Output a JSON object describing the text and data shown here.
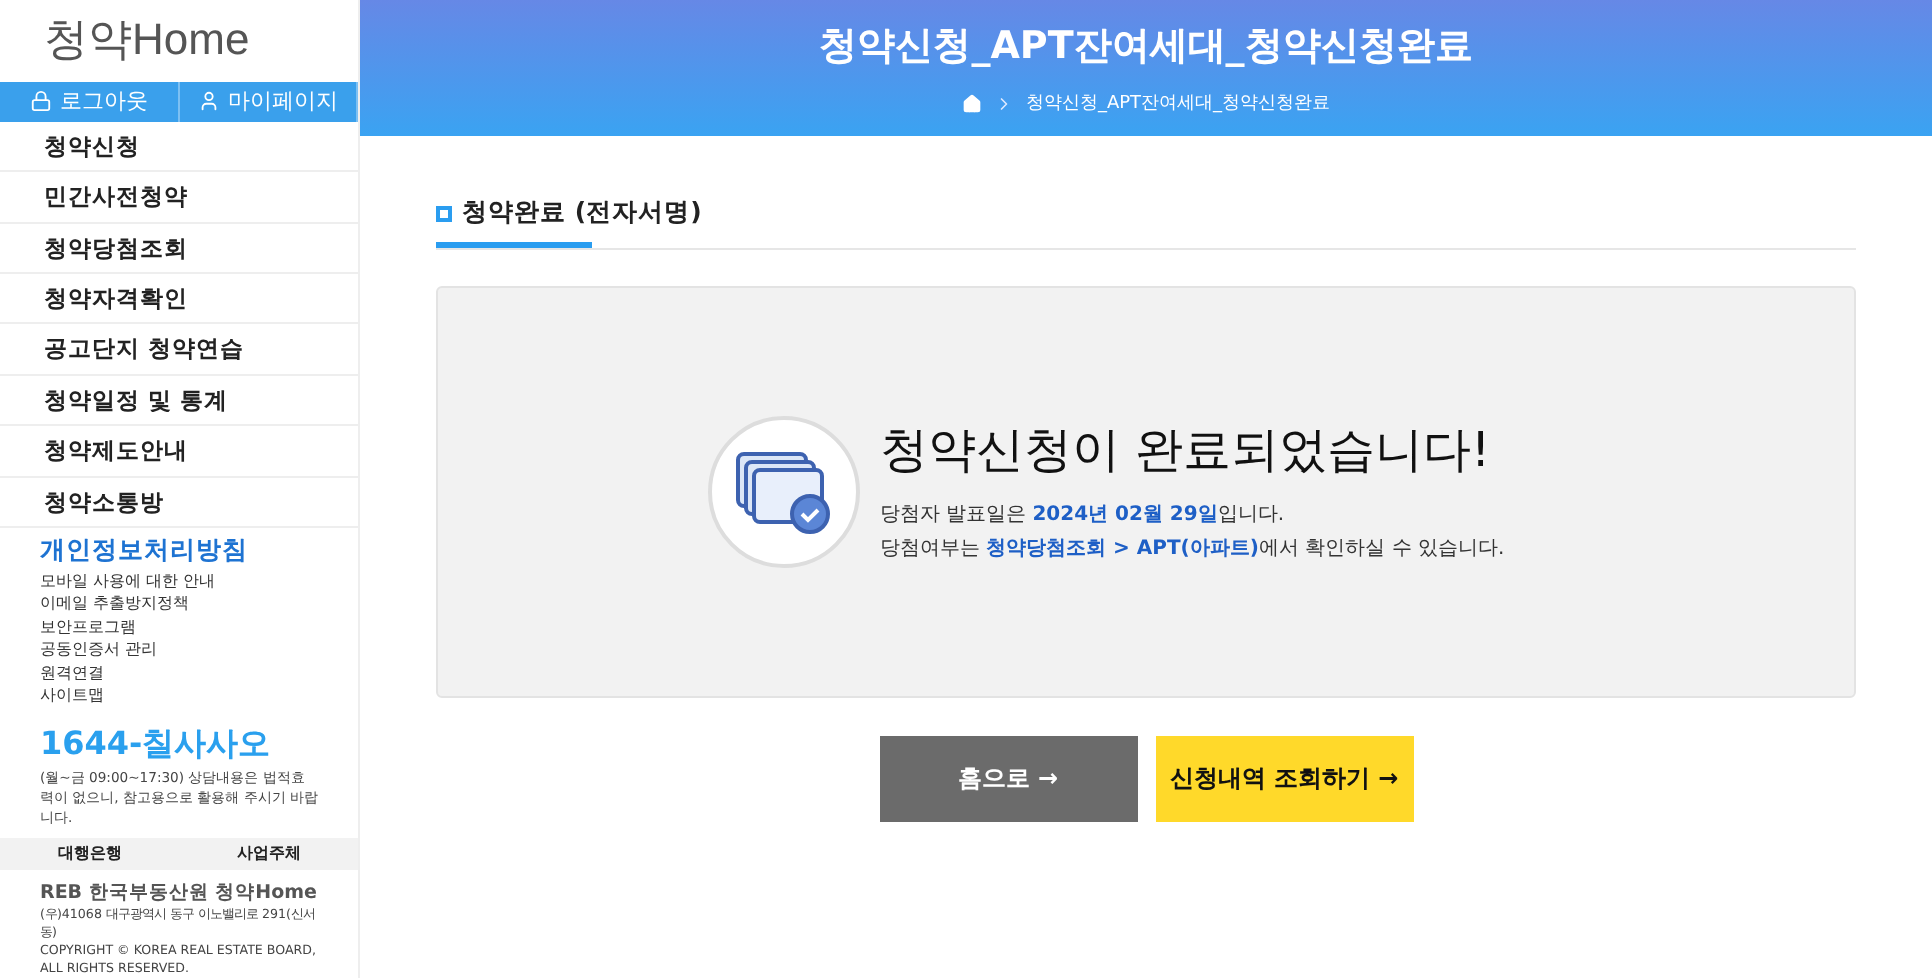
{
  "logo": "청약Home",
  "account_buttons": [
    {
      "kind": "logout",
      "label": "로그아웃"
    },
    {
      "kind": "mypage",
      "label": "마이페이지"
    }
  ],
  "menu": [
    "청약신청",
    "민간사전청약",
    "청약당첨조회",
    "청약자격확인",
    "공고단지 청약연습",
    "청약일정 및 통계",
    "청약제도안내",
    "청약소통방"
  ],
  "privacy": {
    "title": "개인정보처리방침",
    "links": [
      "모바일 사용에 대한 안내",
      "이메일 추출방지정책",
      "보안프로그램",
      "공동인증서 관리",
      "원격연결",
      "사이트맵"
    ]
  },
  "call_center": {
    "number": "1644-칠사사오",
    "note": "(월~금 09:00~17:30) 상담내용은 법적효력이 없으니, 참고용으로 활용해 주시기 바랍니다."
  },
  "partner_links": [
    "대행은행",
    "사업주체"
  ],
  "footer": {
    "org": "REB 한국부동산원 청약Home",
    "address": "(우)41068 대구광역시 동구 이노밸리로 291(신서동)",
    "copyright": "COPYRIGHT © KOREA REAL ESTATE BOARD, ALL RIGHTS RESERVED."
  },
  "header": {
    "title": "청약신청_APT잔여세대_청약신청완료",
    "breadcrumb": [
      "청약신청_APT잔여세대_청약신청완료"
    ]
  },
  "section_title": "청약완료 (전자서명)",
  "result": {
    "headline": "청약신청이 완료되었습니다!",
    "lines": [
      "당첨자 발표일은 **2024년 02월 29일**입니다.",
      "당첨여부는 **청약당첨조회 > APT(아파트)**에서 확인하실 수 있습니다."
    ]
  },
  "actions": [
    {
      "kind": "secondary",
      "label": "홈으로 →"
    },
    {
      "kind": "primary",
      "label": "신청내역 조회하기 →"
    }
  ]
}
